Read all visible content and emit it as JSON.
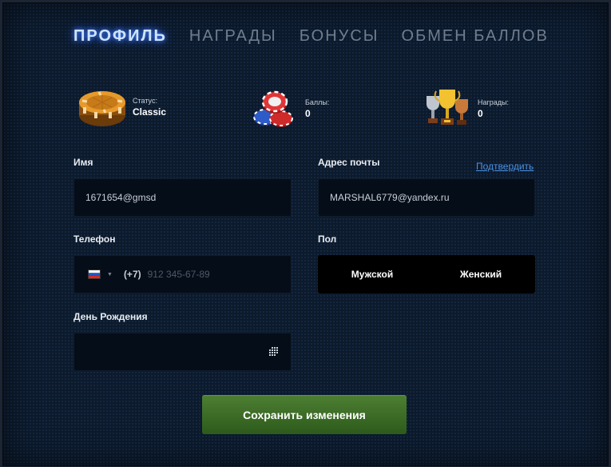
{
  "tabs": [
    {
      "label": "ПРОФИЛЬ",
      "active": true
    },
    {
      "label": "НАГРАДЫ",
      "active": false
    },
    {
      "label": "БОНУСЫ",
      "active": false
    },
    {
      "label": "ОБМЕН БАЛЛОВ",
      "active": false
    }
  ],
  "stats": [
    {
      "label": "Статус:",
      "value": "Classic",
      "icon": "poker-chip-icon"
    },
    {
      "label": "Баллы:",
      "value": "0",
      "icon": "chip-stack-icon"
    },
    {
      "label": "Награды:",
      "value": "0",
      "icon": "trophy-icon"
    }
  ],
  "form": {
    "name": {
      "label": "Имя",
      "value": "1671654@gmsd"
    },
    "email": {
      "label": "Адрес почты",
      "value": "MARSHAL6779@yandex.ru",
      "confirm_link": "Подтвердить"
    },
    "phone": {
      "label": "Телефон",
      "country_code": "(+7)",
      "placeholder": "912 345-67-89",
      "flag": "russia-flag-icon"
    },
    "gender": {
      "label": "Пол",
      "options": [
        "Мужской",
        "Женский"
      ]
    },
    "birthday": {
      "label": "День Рождения",
      "value": ""
    }
  },
  "save_button": "Сохранить изменения",
  "colors": {
    "background": "#0c1a2c",
    "active_tab_glow": "#3f7fff",
    "link": "#4a90e2",
    "save_button": "#3d6e27"
  }
}
